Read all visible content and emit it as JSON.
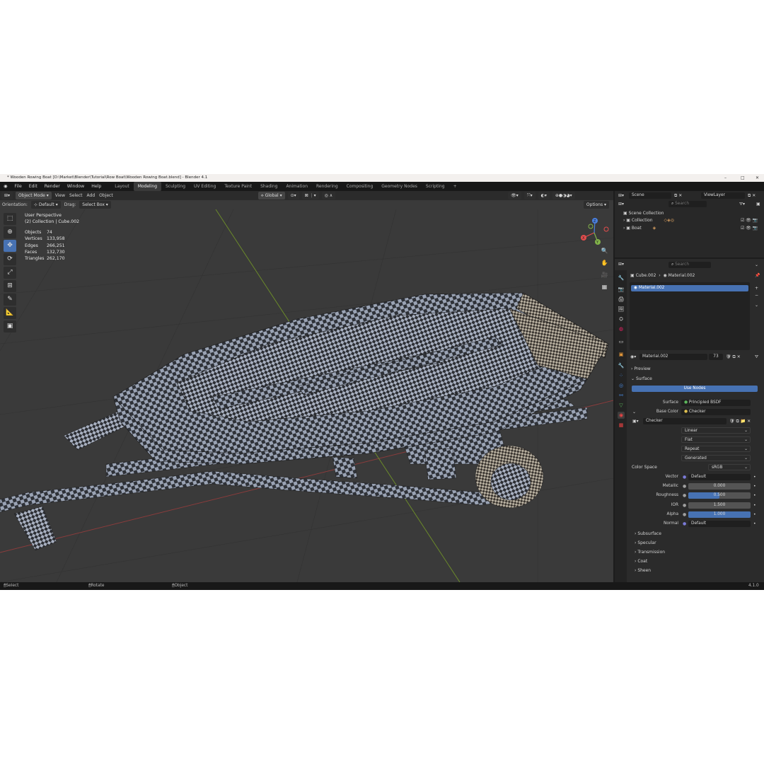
{
  "window": {
    "title": "* Wooden Rowing Boat [D:\\Market\\Blender\\Tutorial\\Row Boat\\Wooden Rowing Boat.blend] - Blender 4.1",
    "controls": [
      "–",
      "□",
      "✕"
    ]
  },
  "menubar": {
    "menus": [
      "File",
      "Edit",
      "Render",
      "Window",
      "Help"
    ],
    "workspaces": [
      "Layout",
      "Modeling",
      "Sculpting",
      "UV Editing",
      "Texture Paint",
      "Shading",
      "Animation",
      "Rendering",
      "Compositing",
      "Geometry Nodes",
      "Scripting",
      "+"
    ],
    "active_workspace": "Modeling"
  },
  "viewport": {
    "mode": "Object Mode",
    "menus": [
      "View",
      "Select",
      "Add",
      "Object"
    ],
    "transform": "Global",
    "orientation_label": "Orientation:",
    "orientation_value": "Default",
    "drag_label": "Drag:",
    "drag_value": "Select Box",
    "options_label": "Options",
    "perspective": "User Perspective",
    "collection_info": "(2) Collection | Cube.002",
    "stats": [
      {
        "label": "Objects",
        "value": "74"
      },
      {
        "label": "Vertices",
        "value": "133,958"
      },
      {
        "label": "Edges",
        "value": "266,251"
      },
      {
        "label": "Faces",
        "value": "132,730"
      },
      {
        "label": "Triangles",
        "value": "262,170"
      }
    ],
    "gizmo_axes": {
      "x": "X",
      "y": "Y",
      "z": "Z"
    }
  },
  "statusbar": {
    "select": "Select",
    "rotate": "Rotate View",
    "object": "Object",
    "version": "4.1.0"
  },
  "outliner": {
    "scene_label": "Scene",
    "viewlayer_label": "ViewLayer",
    "search_placeholder": "Search",
    "root": "Scene Collection",
    "items": [
      {
        "label": "Collection"
      },
      {
        "label": "Boat"
      }
    ]
  },
  "properties": {
    "search_placeholder": "Search",
    "breadcrumb_object": "Cube.002",
    "breadcrumb_material": "Material.002",
    "slot": "Material.002",
    "material_name": "Material.002",
    "user_count": "73",
    "panels": {
      "preview": "Preview",
      "surface": "Surface",
      "use_nodes": "Use Nodes"
    },
    "surface": {
      "label": "Surface",
      "value": "Principled BSDF"
    },
    "base_color": {
      "label": "Base Color",
      "value": "Checker"
    },
    "texture": {
      "name": "Checker",
      "interpolation": "Linear",
      "projection": "Flat",
      "extension": "Repeat",
      "source": "Generated",
      "color_space_label": "Color Space",
      "color_space": "sRGB"
    },
    "inputs": [
      {
        "label": "Vector",
        "value": "Default",
        "kind": "link"
      },
      {
        "label": "Metallic",
        "value": "0.000",
        "kind": "num",
        "fill": 0.0
      },
      {
        "label": "Roughness",
        "value": "0.500",
        "kind": "num",
        "fill": 0.5
      },
      {
        "label": "IOR",
        "value": "1.500",
        "kind": "num",
        "fill": 0.0
      },
      {
        "label": "Alpha",
        "value": "1.000",
        "kind": "num",
        "fill": 1.0
      },
      {
        "label": "Normal",
        "value": "Default",
        "kind": "link"
      }
    ],
    "subpanels": [
      "Subsurface",
      "Specular",
      "Transmission",
      "Coat",
      "Sheen"
    ]
  },
  "colors": {
    "accent": "#4772b3",
    "viewport_bg": "#3a3a3a",
    "panel_bg": "#2b2b2b",
    "axis_x": "#e44d4d",
    "axis_y": "#82b34a",
    "axis_z": "#4a80e0"
  }
}
